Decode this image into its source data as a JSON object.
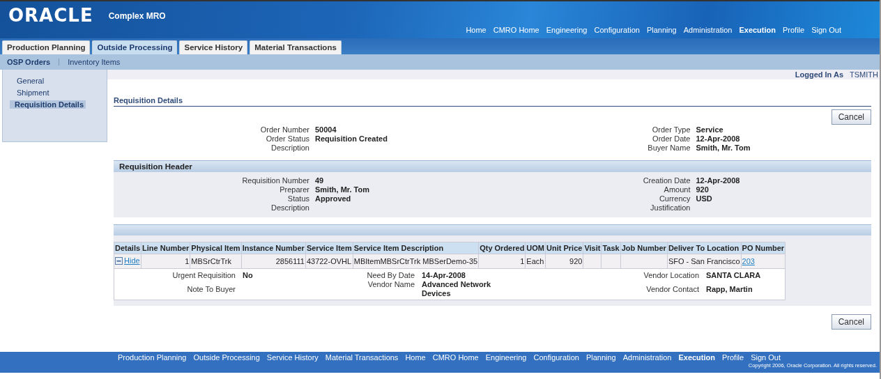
{
  "header": {
    "logo": "ORACLE",
    "app_name": "Complex MRO",
    "global_nav": [
      {
        "label": "Home",
        "selected": false
      },
      {
        "label": "CMRO Home",
        "selected": false
      },
      {
        "label": "Engineering",
        "selected": false
      },
      {
        "label": "Configuration",
        "selected": false
      },
      {
        "label": "Planning",
        "selected": false
      },
      {
        "label": "Administration",
        "selected": false
      },
      {
        "label": "Execution",
        "selected": true
      },
      {
        "label": "Profile",
        "selected": false
      },
      {
        "label": "Sign Out",
        "selected": false
      }
    ]
  },
  "tabs": [
    {
      "label": "Production Planning",
      "selected": false
    },
    {
      "label": "Outside Processing",
      "selected": true
    },
    {
      "label": "Service History",
      "selected": false
    },
    {
      "label": "Material Transactions",
      "selected": false
    }
  ],
  "subtabs": [
    {
      "label": "OSP Orders",
      "selected": true
    },
    {
      "label": "Inventory Items",
      "selected": false
    }
  ],
  "user": {
    "label": "Logged In As",
    "name": "TSMITH"
  },
  "side_nav": [
    {
      "label": "General",
      "selected": false
    },
    {
      "label": "Shipment",
      "selected": false
    },
    {
      "label": "Requisition Details",
      "selected": true
    }
  ],
  "page_title": "Requisition Details",
  "cancel_buttons": [
    "Cancel",
    "Cancel"
  ],
  "order_fields": {
    "left": [
      {
        "label": "Order Number",
        "value": "50004"
      },
      {
        "label": "Order Status",
        "value": "Requisition Created"
      },
      {
        "label": "Description"
      }
    ],
    "right": [
      {
        "label": "Order Type",
        "value": "Service"
      },
      {
        "label": "Order Date",
        "value": "12-Apr-2008"
      },
      {
        "label": "Buyer Name",
        "value": "Smith, Mr. Tom"
      }
    ]
  },
  "requisition_header": {
    "title": "Requisition Header",
    "left": [
      {
        "label": "Requisition Number",
        "value": "49"
      },
      {
        "label": "Preparer",
        "value": "Smith, Mr. Tom"
      },
      {
        "label": "Status",
        "value": "Approved"
      },
      {
        "label": "Description"
      }
    ],
    "right": [
      {
        "label": "Creation Date",
        "value": "12-Apr-2008"
      },
      {
        "label": "Amount",
        "value": "920"
      },
      {
        "label": "Currency",
        "value": "USD"
      },
      {
        "label": "Justification"
      }
    ]
  },
  "lines_table": {
    "columns": [
      {
        "label": "Details",
        "kind": "toggle"
      },
      {
        "label": "Line Number",
        "kind": "number"
      },
      {
        "label": "Physical Item",
        "kind": "text"
      },
      {
        "label": "Instance Number",
        "kind": "number"
      },
      {
        "label": "Service Item",
        "kind": "text"
      },
      {
        "label": "Service Item Description",
        "kind": "text"
      },
      {
        "label": "Qty Ordered",
        "kind": "number"
      },
      {
        "label": "UOM",
        "kind": "text"
      },
      {
        "label": "Unit Price",
        "kind": "number"
      },
      {
        "label": "Visit",
        "kind": "text"
      },
      {
        "label": "Task",
        "kind": "text"
      },
      {
        "label": "Job Number",
        "kind": "text"
      },
      {
        "label": "Deliver To Location",
        "kind": "text"
      },
      {
        "label": "PO Number",
        "kind": "link"
      }
    ],
    "rows": [
      {
        "details": {
          "label": "Hide",
          "expanded": true
        },
        "cells": [
          {},
          {
            "text": "1"
          },
          {
            "text": "MBSrCtrTrk"
          },
          {
            "text": "2856111"
          },
          {
            "text": "43722-OVHL"
          },
          {
            "text": "MBItemMBSrCtrTrk MBSerDemo-35"
          },
          {
            "text": "1"
          },
          {
            "text": "Each"
          },
          {
            "text": "920"
          },
          {},
          {},
          {},
          {
            "text": "SFO - San Francisco"
          },
          {
            "text": "203"
          }
        ],
        "detail_groups": [
          [
            {
              "label": "Urgent Requisition",
              "value": "No"
            },
            {
              "label": "Note To Buyer"
            }
          ],
          [
            {
              "label": "Need By Date",
              "value": "14-Apr-2008"
            },
            {
              "label": "Vendor Name",
              "value": "Advanced Network Devices"
            }
          ],
          [
            {
              "label": "Vendor Location",
              "value": "SANTA CLARA"
            },
            {
              "label": "Vendor Contact",
              "value": "Rapp, Martin"
            }
          ]
        ]
      }
    ]
  },
  "footer": {
    "nav": [
      {
        "label": "Production Planning",
        "selected": false
      },
      {
        "label": "Outside Processing",
        "selected": false
      },
      {
        "label": "Service History",
        "selected": false
      },
      {
        "label": "Material Transactions",
        "selected": false
      },
      {
        "label": "Home",
        "selected": false
      },
      {
        "label": "CMRO Home",
        "selected": false
      },
      {
        "label": "Engineering",
        "selected": false
      },
      {
        "label": "Configuration",
        "selected": false
      },
      {
        "label": "Planning",
        "selected": false
      },
      {
        "label": "Administration",
        "selected": false
      },
      {
        "label": "Execution",
        "selected": true
      },
      {
        "label": "Profile",
        "selected": false
      },
      {
        "label": "Sign Out",
        "selected": false
      }
    ],
    "copyright": "Copyright 2006, Oracle Corporation. All rights reserved."
  }
}
